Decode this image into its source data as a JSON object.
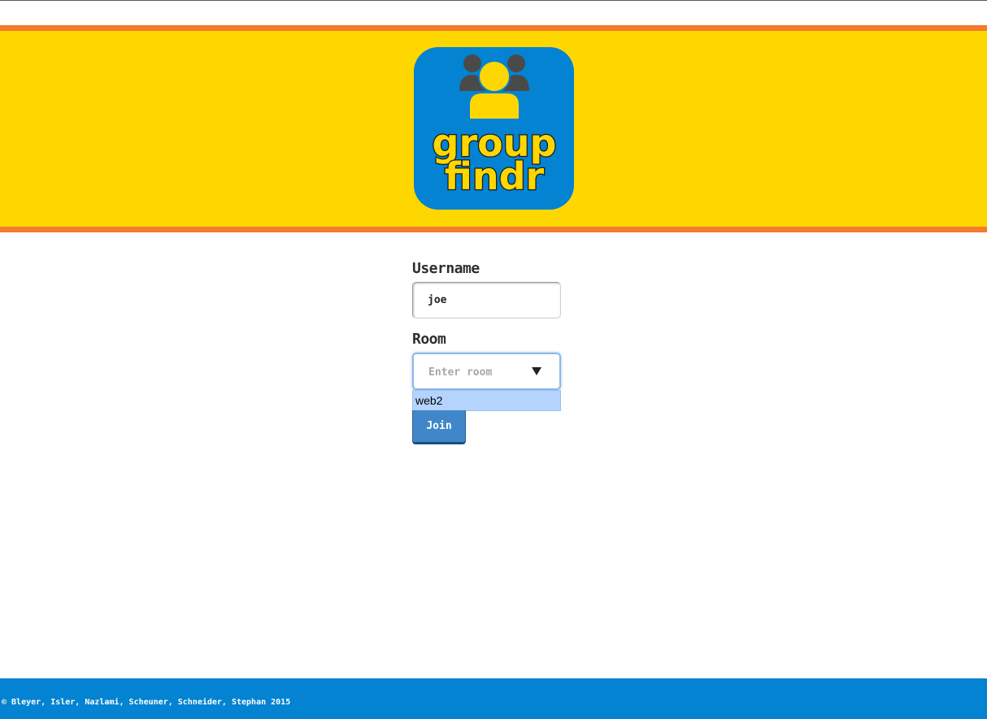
{
  "header": {
    "logo": {
      "icon": "group-people-icon",
      "line1": "group",
      "line2": "findr",
      "background_color": "#0383D1",
      "text_color": "#FFD700"
    },
    "background_color": "#FFD700",
    "border_color": "#F47A2C"
  },
  "form": {
    "username_label": "Username",
    "username_value": "joe",
    "room_label": "Room",
    "room_placeholder": "Enter room",
    "room_value": "",
    "room_options": [
      "web2"
    ],
    "join_label": "Join"
  },
  "footer": {
    "text": "©  Bleyer, Isler, Nazlami, Scheuner, Schneider, Stephan 2015",
    "background_color": "#0383D1"
  }
}
